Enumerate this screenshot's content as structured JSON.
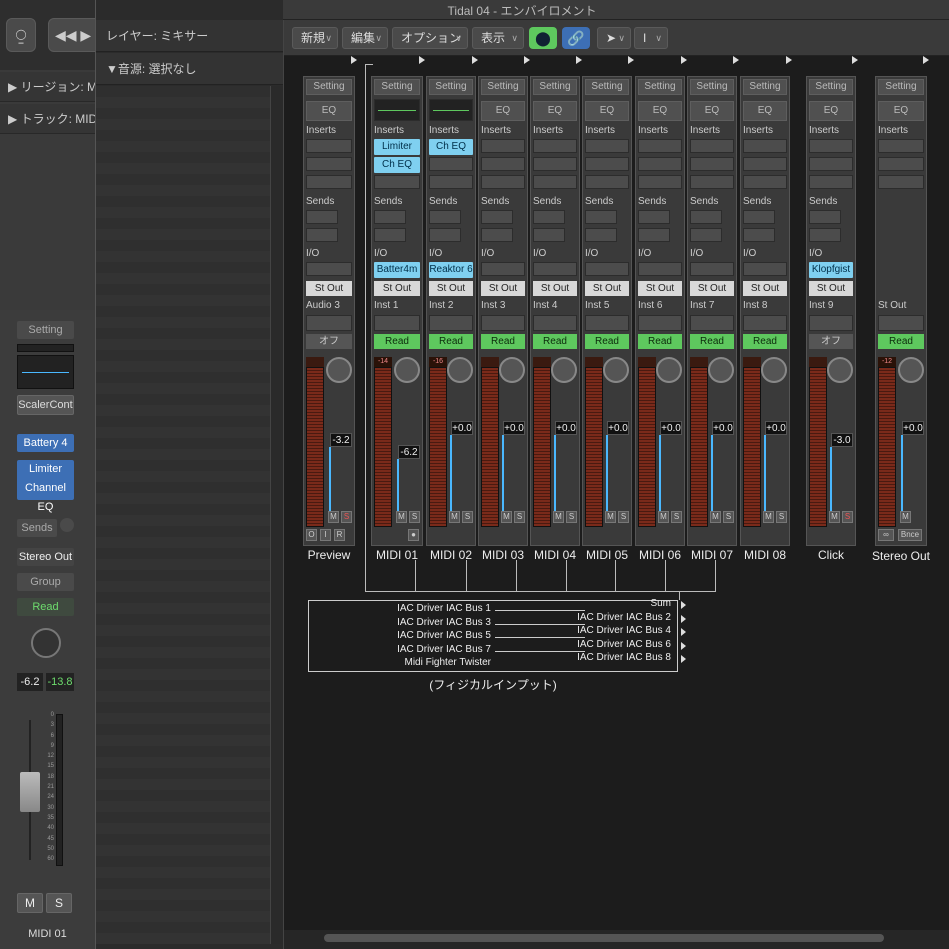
{
  "window": {
    "title": "Tidal 04 - エンバイロメント"
  },
  "left_panel": {
    "region_label": "リージョン: MIDI",
    "track_label": "トラック: MIDI",
    "setting": "Setting",
    "plugin_name": "ScalerCont",
    "instrument": "Battery 4",
    "inserts": [
      "Limiter",
      "Channel EQ"
    ],
    "sends": "Sends",
    "output": "Stereo Out",
    "group": "Group",
    "automation": "Read",
    "volume": "-6.2",
    "peak": "-13.8",
    "scale": [
      "0",
      "3",
      "6",
      "9",
      "12",
      "15",
      "18",
      "21",
      "24",
      "30",
      "35",
      "40",
      "45",
      "50",
      "60"
    ],
    "mute": "M",
    "solo": "S",
    "name": "MIDI 01"
  },
  "middle_panel": {
    "layer_label": "レイヤー: ミキサー",
    "source_label": "▼音源: 選択なし"
  },
  "toolbar": {
    "new": "新規",
    "edit": "編集",
    "options": "オプション",
    "view": "表示"
  },
  "strips": [
    {
      "name": "Preview",
      "setting": "Setting",
      "eq": "EQ",
      "inserts_label": "Inserts",
      "sends_label": "Sends",
      "io_label": "I/O",
      "output": "St Out",
      "input": "Audio 3",
      "auto": "オフ",
      "volume": "-3.2",
      "peak": ""
    },
    {
      "name": "MIDI 01",
      "setting": "Setting",
      "eq": "EQ",
      "inserts_label": "Inserts",
      "sends_label": "Sends",
      "io_label": "I/O",
      "output": "St Out",
      "input": "Inst 1",
      "auto": "Read",
      "volume": "-6.2",
      "peak": "-14",
      "plugins": [
        "Limiter",
        "Ch EQ"
      ],
      "instrument": "Batter4m"
    },
    {
      "name": "MIDI 02",
      "setting": "Setting",
      "eq": "EQ",
      "inserts_label": "Inserts",
      "sends_label": "Sends",
      "io_label": "I/O",
      "output": "St Out",
      "input": "Inst 2",
      "auto": "Read",
      "volume": "+0.0",
      "peak": "-16",
      "plugins": [
        "Ch EQ"
      ],
      "instrument": "Reaktor 6"
    },
    {
      "name": "MIDI 03",
      "setting": "Setting",
      "eq": "EQ",
      "inserts_label": "Inserts",
      "sends_label": "Sends",
      "io_label": "I/O",
      "output": "St Out",
      "input": "Inst 3",
      "auto": "Read",
      "volume": "+0.0",
      "peak": ""
    },
    {
      "name": "MIDI 04",
      "setting": "Setting",
      "eq": "EQ",
      "inserts_label": "Inserts",
      "sends_label": "Sends",
      "io_label": "I/O",
      "output": "St Out",
      "input": "Inst 4",
      "auto": "Read",
      "volume": "+0.0",
      "peak": ""
    },
    {
      "name": "MIDI 05",
      "setting": "Setting",
      "eq": "EQ",
      "inserts_label": "Inserts",
      "sends_label": "Sends",
      "io_label": "I/O",
      "output": "St Out",
      "input": "Inst 5",
      "auto": "Read",
      "volume": "+0.0",
      "peak": ""
    },
    {
      "name": "MIDI 06",
      "setting": "Setting",
      "eq": "EQ",
      "inserts_label": "Inserts",
      "sends_label": "Sends",
      "io_label": "I/O",
      "output": "St Out",
      "input": "Inst 6",
      "auto": "Read",
      "volume": "+0.0",
      "peak": ""
    },
    {
      "name": "MIDI 07",
      "setting": "Setting",
      "eq": "EQ",
      "inserts_label": "Inserts",
      "sends_label": "Sends",
      "io_label": "I/O",
      "output": "St Out",
      "input": "Inst 7",
      "auto": "Read",
      "volume": "+0.0",
      "peak": ""
    },
    {
      "name": "MIDI 08",
      "setting": "Setting",
      "eq": "EQ",
      "inserts_label": "Inserts",
      "sends_label": "Sends",
      "io_label": "I/O",
      "output": "St Out",
      "input": "Inst 8",
      "auto": "Read",
      "volume": "+0.0",
      "peak": ""
    },
    {
      "name": "Click",
      "setting": "Setting",
      "eq": "EQ",
      "inserts_label": "Inserts",
      "sends_label": "Sends",
      "io_label": "I/O",
      "output": "St Out",
      "input": "Inst 9",
      "auto": "オフ",
      "volume": "-3.0",
      "peak": "",
      "instrument": "Klopfgist"
    },
    {
      "name": "Stereo Out",
      "setting": "Setting",
      "eq": "EQ",
      "inserts_label": "Inserts",
      "sends_label": "",
      "io_label": "",
      "output": "St Out",
      "input": "",
      "auto": "Read",
      "volume": "+0.0",
      "peak": "-12"
    }
  ],
  "physical_input": {
    "caption": "(フィジカルインプット)",
    "left": [
      "IAC Driver IAC Bus 1",
      "IAC Driver IAC Bus 3",
      "IAC Driver IAC Bus 5",
      "IAC Driver IAC Bus 7",
      "Midi Fighter Twister"
    ],
    "right": [
      "Sum",
      "IAC Driver IAC Bus 2",
      "IAC Driver IAC Bus 4",
      "IAC Driver IAC Bus 6",
      "IAC Driver IAC Bus 8"
    ]
  },
  "colors": {
    "plugin_blue": "#7fd0f0",
    "read_green": "#5ec85e",
    "fader_blue": "#4ab8ff"
  }
}
